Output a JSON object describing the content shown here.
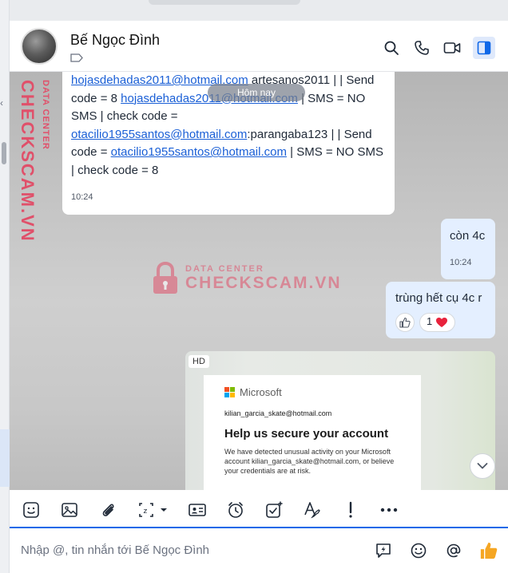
{
  "header": {
    "contact_name": "Bế Ngọc Đình"
  },
  "watermark": {
    "vertical_big": "CHECKSCAM.VN",
    "vertical_small": "DATA CENTER",
    "line1": "DATA CENTER",
    "line2": "CHECKSCAM.VN"
  },
  "messages": {
    "m1": {
      "link1": "hojasdehadas2011@hotmail.com",
      "text1": " artesanos2011 |  | Send code = 8 ",
      "link2": "hojasdehadas2011@hotmail.com",
      "text2": " | SMS = NO SMS | check code = ",
      "link3": "otacilio1955santos@hotmail.com",
      "text3": ":parangaba123 |  | Send code = ",
      "link4": "otacilio1955santos@hotmail.com",
      "text4": " | SMS = NO SMS | check code = 8",
      "time": "10:24"
    },
    "day_divider": "Hôm nay",
    "m2": {
      "text": "còn 4c",
      "time": "10:24"
    },
    "m3": {
      "text": "trùng hết cụ 4c r",
      "reaction_count": "1"
    },
    "image": {
      "badge": "HD",
      "brand": "Microsoft",
      "email": "kilian_garcia_skate@hotmail.com",
      "title": "Help us secure your account",
      "body": "We have detected unusual activity on your Microsoft account kilian_garcia_skate@hotmail.com, or believe your credentials are at risk."
    }
  },
  "composer": {
    "placeholder": "Nhập @, tin nhắn tới Bế Ngọc Đình"
  },
  "colors": {
    "accent": "#0f68e8",
    "my_bubble": "#e4efff",
    "link": "#1a5fd6",
    "watermark": "#e0506a",
    "like": "#f5a623"
  }
}
